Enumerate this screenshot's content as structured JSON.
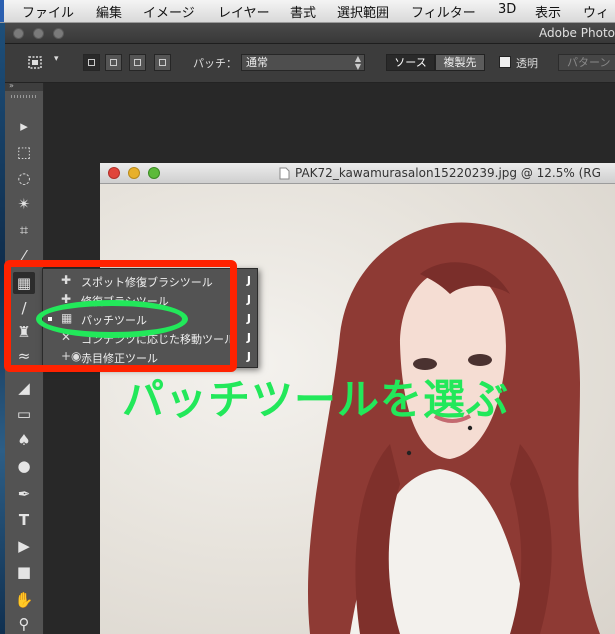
{
  "menubar": {
    "items": [
      "ファイル",
      "編集",
      "イメージ",
      "レイヤー",
      "書式",
      "選択範囲",
      "フィルター",
      "3D",
      "表示",
      "ウィ"
    ]
  },
  "window": {
    "title": "Adobe Photo"
  },
  "options_bar": {
    "patch_label": "パッチ：",
    "patch_mode": "通常",
    "source_label": "ソース",
    "dest_label": "複製先",
    "transparent_label": "透明",
    "pattern_label": "パターン"
  },
  "document": {
    "title": "PAK72_kawamurasalon15220239.jpg @ 12.5% (RG"
  },
  "flyout": {
    "items": [
      {
        "label": "スポット修復ブラシツール",
        "key": "J",
        "icon": "spot-healing-brush-icon",
        "selected": false
      },
      {
        "label": "修復ブラシツール",
        "key": "J",
        "icon": "healing-brush-icon",
        "selected": false
      },
      {
        "label": "パッチツール",
        "key": "J",
        "icon": "patch-icon",
        "selected": true
      },
      {
        "label": "コンテンツに応じた移動ツール",
        "key": "J",
        "icon": "content-aware-move-icon",
        "selected": false
      },
      {
        "label": "赤目修正ツール",
        "key": "J",
        "icon": "red-eye-icon",
        "selected": false
      }
    ]
  },
  "annotation": {
    "caption": "パッチツールを選ぶ",
    "red_color": "#ff2200",
    "green_color": "#22e85a"
  },
  "tools": [
    "move-icon",
    "marquee-icon",
    "lasso-icon",
    "magic-wand-icon",
    "crop-icon",
    "eyedropper-icon",
    "patch-icon",
    "brush-icon",
    "stamp-icon",
    "history-brush-icon",
    "eraser-icon",
    "gradient-icon",
    "blur-icon",
    "dodge-icon",
    "pen-icon",
    "type-icon",
    "path-selection-icon",
    "rectangle-icon",
    "hand-icon",
    "zoom-icon"
  ]
}
